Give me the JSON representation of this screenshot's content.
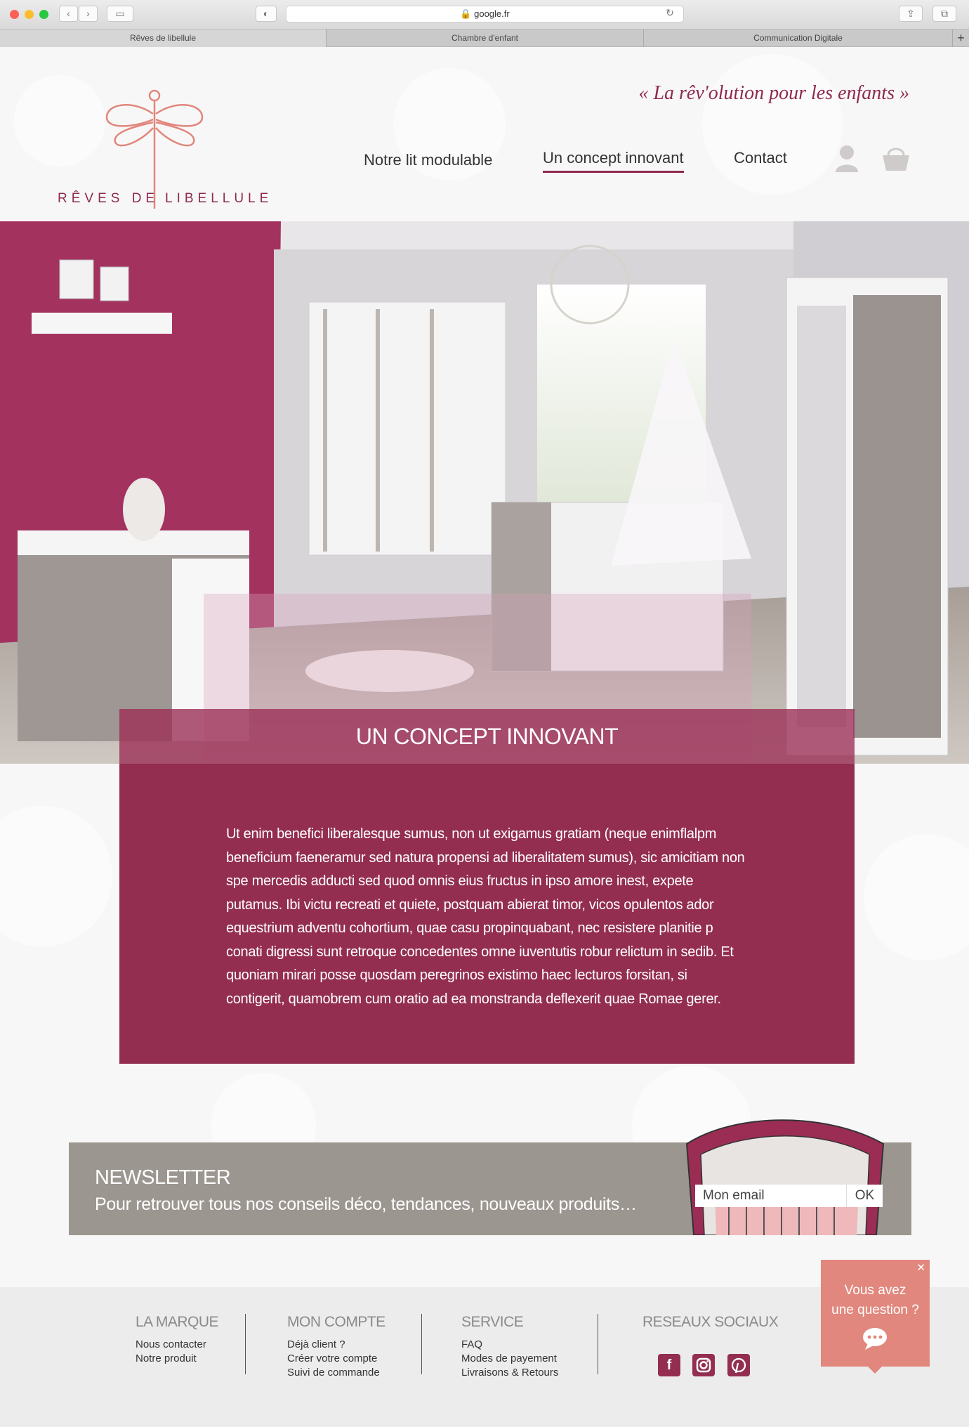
{
  "browser": {
    "url": "google.fr",
    "tabs": [
      "Rêves de libellule",
      "Chambre d'enfant",
      "Communication Digitale"
    ]
  },
  "header": {
    "tagline": "« La rêv'olution pour les enfants »",
    "logo_left": "RÊVES DE",
    "logo_right": "LIBELLULE",
    "menu": [
      "Notre lit modulable",
      "Un concept innovant",
      "Contact"
    ],
    "active_menu": "Un concept innovant"
  },
  "hero": {
    "title": "UN CONCEPT INNOVANT"
  },
  "content": {
    "text": "Ut enim benefici liberalesque sumus, non ut exigamus gratiam (neque enimflalpm beneficium faeneramur sed natura propensi ad liberalitatem sumus), sic amicitiam non spe mercedis adducti sed quod omnis eius fructus in ipso amore inest, expete putamus. Ibi victu recreati et quiete, postquam abierat timor, vicos opulentos ador equestrium adventu cohortium, quae casu propinquabant, nec resistere planitie p conati digressi sunt retroque concedentes omne iuventutis robur relictum in sedib. Et quoniam mirari posse quosdam peregrinos existimo haec lecturos forsitan, si contigerit, quamobrem cum oratio ad ea monstranda deflexerit quae Romae gerer."
  },
  "newsletter": {
    "title": "NEWSLETTER",
    "subtitle": "Pour retrouver tous nos conseils déco, tendances, nouveaux produits…",
    "email_value": "Mon email",
    "ok_label": "OK"
  },
  "footer": {
    "marque": {
      "title": "LA MARQUE",
      "links": [
        "Nous contacter",
        "Notre produit"
      ]
    },
    "compte": {
      "title": "MON COMPTE",
      "links": [
        "Déjà client ?",
        "Créer votre compte",
        "Suivi de commande"
      ]
    },
    "service": {
      "title": "SERVICE",
      "links": [
        "FAQ",
        "Modes de payement",
        "Livraisons & Retours"
      ]
    },
    "social": {
      "title": "RESEAUX SOCIAUX",
      "icons": [
        "facebook-icon",
        "instagram-icon",
        "pinterest-icon"
      ]
    }
  },
  "chat": {
    "line1": "Vous avez",
    "line2": "une question ?"
  },
  "colors": {
    "brand": "#932e50",
    "accent": "#e1877d",
    "newsletter_bg": "#9c9690"
  }
}
